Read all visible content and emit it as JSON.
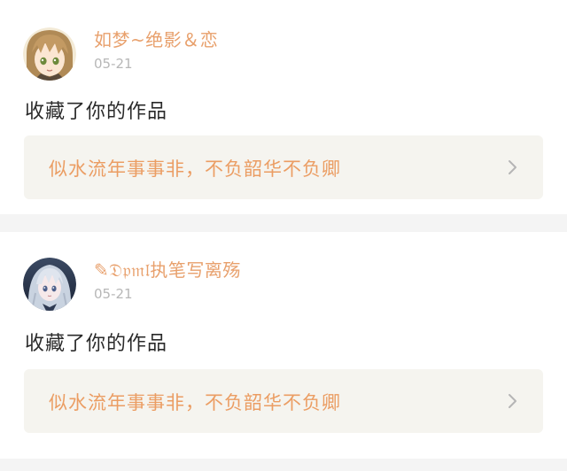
{
  "feed": {
    "items": [
      {
        "username": "如梦~绝影＆恋",
        "date": "05-21",
        "action": "收藏了你的作品",
        "work_title": "似水流年事事非，不负韶华不负卿",
        "avatar_icon": "anime-boy-avatar-icon"
      },
      {
        "username": "✎𝔇𝔭𝔪𝔩执笔写离殇",
        "date": "05-21",
        "action": "收藏了你的作品",
        "work_title": "似水流年事事非，不负韶华不负卿",
        "avatar_icon": "anime-girl-avatar-icon"
      }
    ]
  },
  "colors": {
    "username": "#e8a06c",
    "work_title": "#eb9d63",
    "link_background": "#f5f4ef",
    "date": "#b7b7b7",
    "separator": "#f4f4f4"
  }
}
